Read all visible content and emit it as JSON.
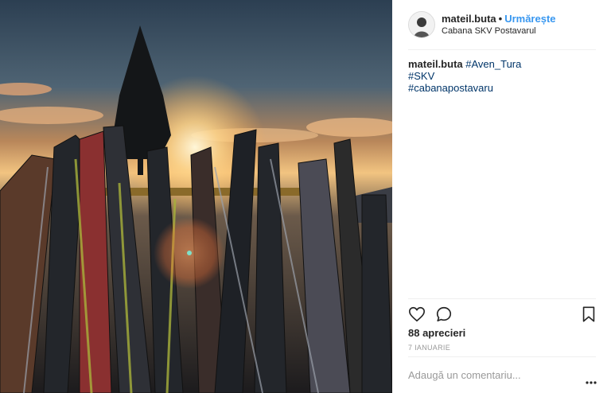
{
  "post": {
    "username": "mateil.buta",
    "separator": "•",
    "follow_label": "Urmărește",
    "location": "Cabana SKV Postavarul",
    "caption_username": "mateil.buta",
    "hashtags": [
      "#Aven_Tura",
      "#SKV",
      "#cabanapostavaru"
    ],
    "likes": "88 aprecieri",
    "date": "7 IANUARIE",
    "comment_placeholder": "Adaugă un comentariu...",
    "more_label": "..."
  },
  "icons": {
    "like": "heart-icon",
    "comment": "comment-icon",
    "save": "bookmark-icon",
    "more": "more-options-icon"
  },
  "colors": {
    "follow": "#3897f0",
    "hashtag": "#003569",
    "muted": "#999999",
    "text": "#262626"
  }
}
